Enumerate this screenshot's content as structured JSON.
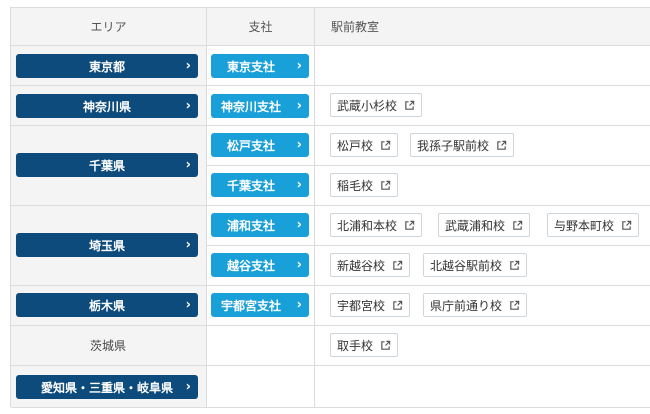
{
  "headers": {
    "area": "エリア",
    "branch": "支社",
    "school": "駅前教室"
  },
  "tokyo": {
    "pref": "東京都",
    "branch": "東京支社"
  },
  "kanagawa": {
    "pref": "神奈川県",
    "branch": "神奈川支社",
    "schools": [
      "武蔵小杉校"
    ]
  },
  "chiba": {
    "pref": "千葉県",
    "branch1": "松戸支社",
    "schools1": [
      "松戸校",
      "我孫子駅前校"
    ],
    "branch2": "千葉支社",
    "schools2": [
      "稲毛校"
    ]
  },
  "saitama": {
    "pref": "埼玉県",
    "branch1": "浦和支社",
    "schools1": [
      "北浦和本校",
      "武蔵浦和校",
      "与野本町校"
    ],
    "branch2": "越谷支社",
    "schools2": [
      "新越谷校",
      "北越谷駅前校"
    ]
  },
  "tochigi": {
    "pref": "栃木県",
    "branch": "宇都宮支社",
    "schools": [
      "宇都宮校",
      "県庁前通り校"
    ]
  },
  "ibaraki": {
    "pref": "茨城県",
    "schools": [
      "取手校"
    ]
  },
  "tokai": {
    "pref": "愛知県・三重県・岐阜県"
  },
  "chevron": "›",
  "colors": {
    "prefecture_button": "#0d4b7c",
    "branch_button": "#1aa0d8",
    "header_bg": "#f4f4f4",
    "border": "#dcdcdc"
  }
}
